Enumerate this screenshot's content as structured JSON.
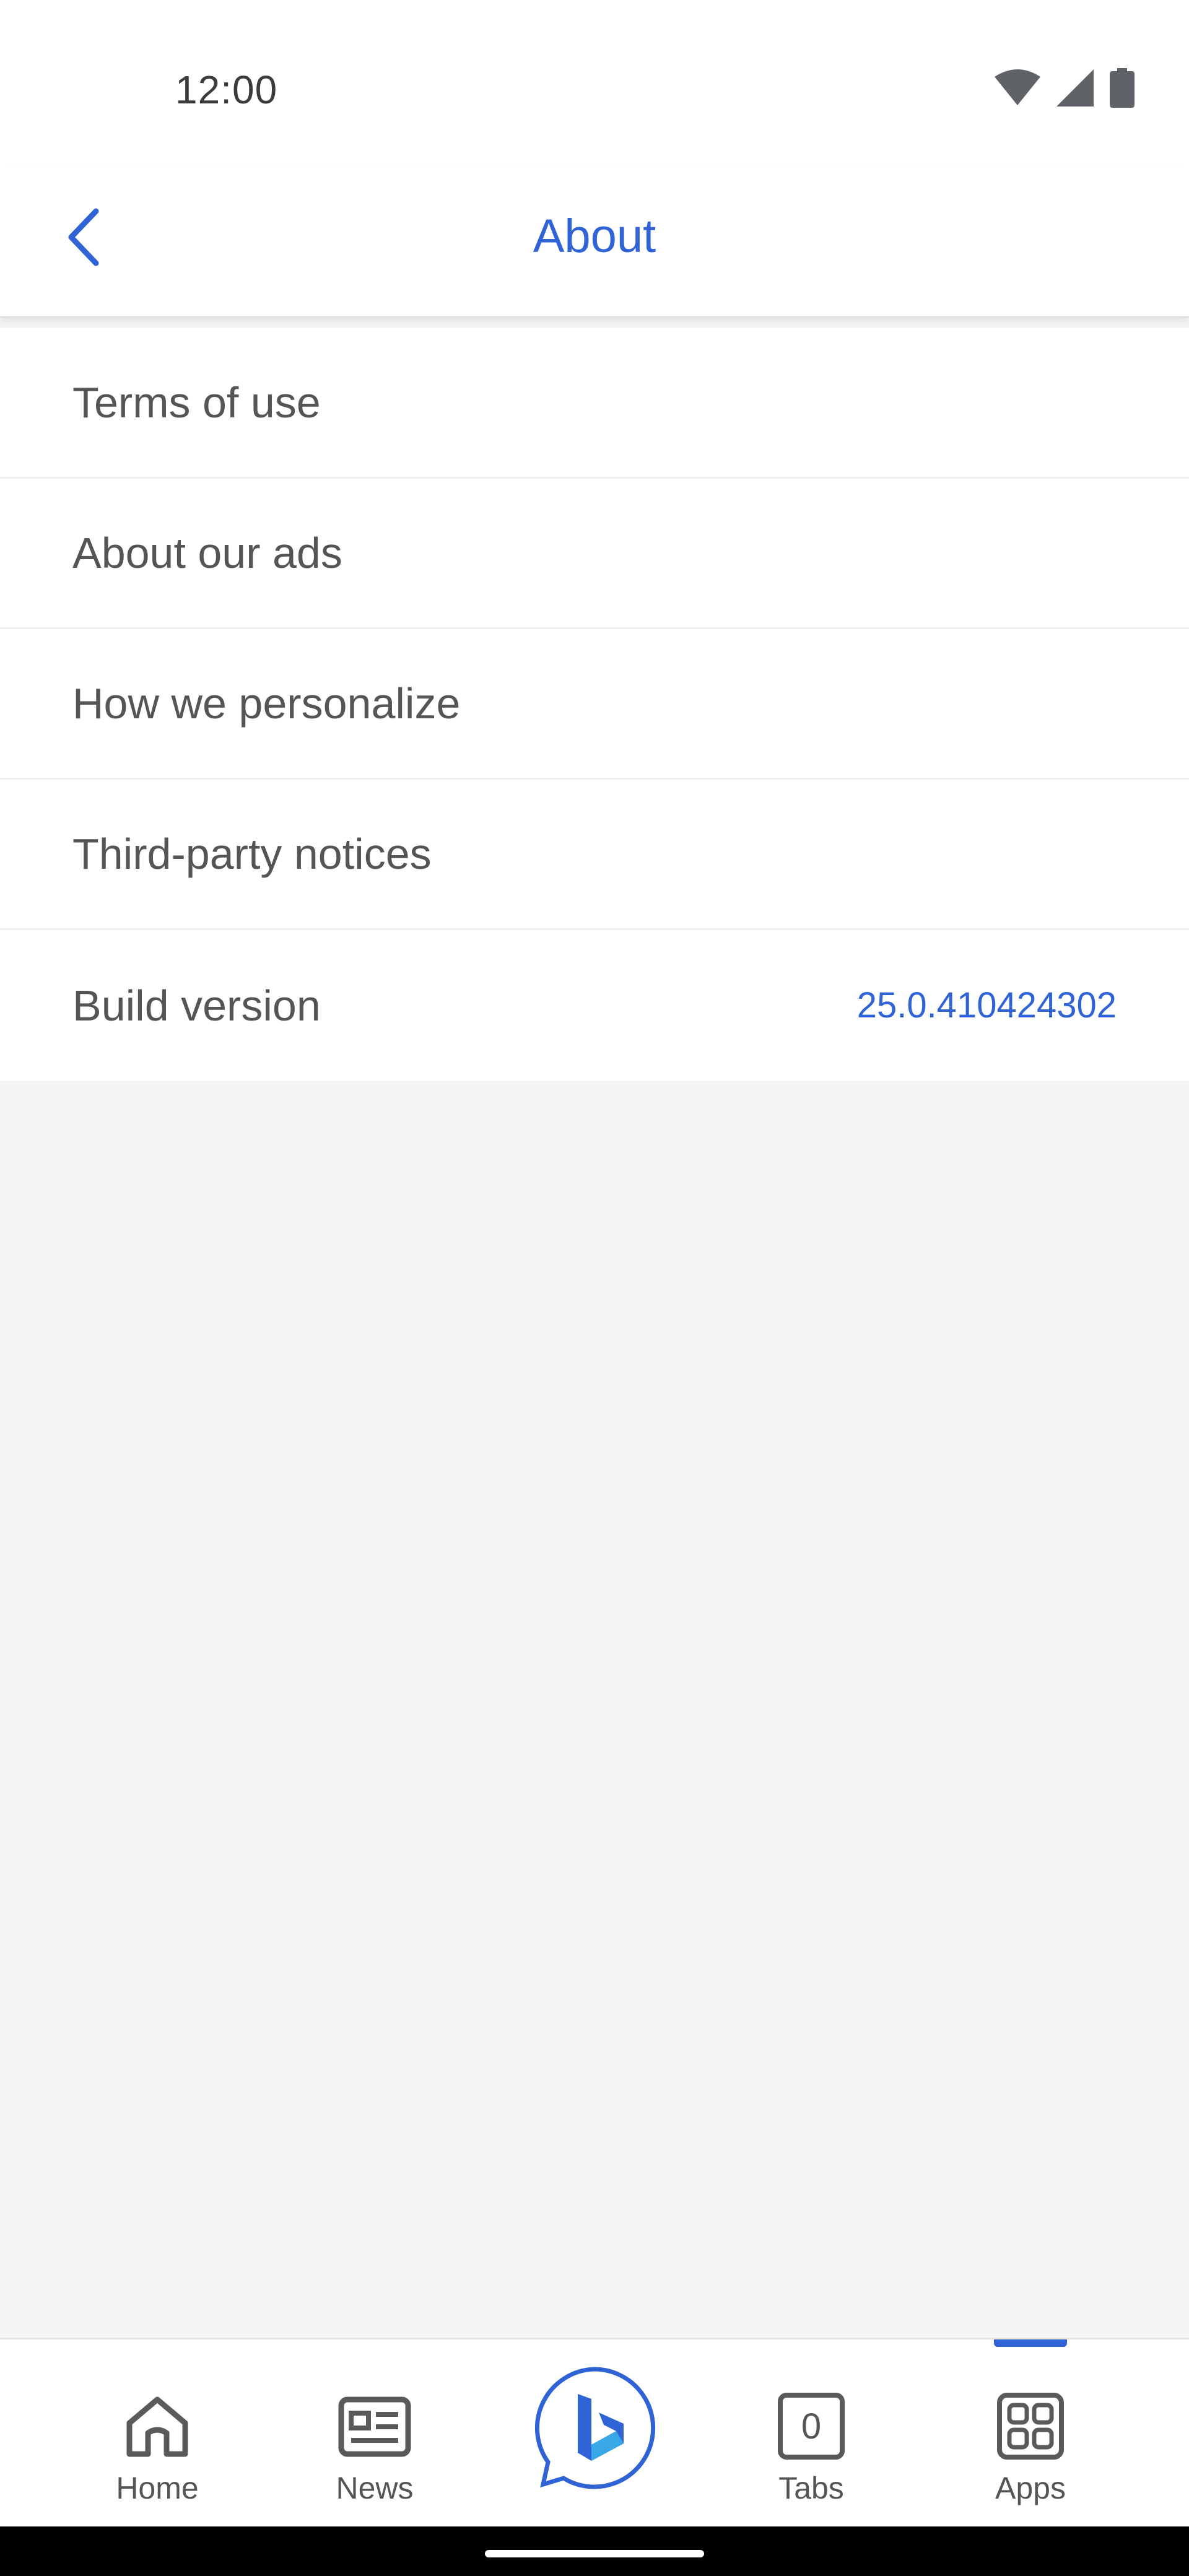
{
  "status_bar": {
    "time": "12:00",
    "icons": [
      "wifi-icon",
      "cellular-signal-icon",
      "battery-icon"
    ]
  },
  "header": {
    "back_icon": "chevron-left-icon",
    "title": "About"
  },
  "list": {
    "items": [
      {
        "label": "Terms of use"
      },
      {
        "label": "About our ads"
      },
      {
        "label": "How we personalize"
      },
      {
        "label": "Third-party notices"
      },
      {
        "label": "Build version",
        "value": "25.0.410424302"
      }
    ]
  },
  "bottom_nav": {
    "items": [
      {
        "label": "Home",
        "icon": "home-icon"
      },
      {
        "label": "News",
        "icon": "news-icon"
      },
      {
        "label": "",
        "icon": "bing-chat-icon"
      },
      {
        "label": "Tabs",
        "icon": "tabs-icon",
        "count": "0"
      },
      {
        "label": "Apps",
        "icon": "apps-grid-icon",
        "active": true
      }
    ]
  },
  "colors": {
    "accent": "#2f63d6",
    "text_primary": "#555555",
    "background": "#f5f5f5",
    "surface": "#ffffff"
  }
}
